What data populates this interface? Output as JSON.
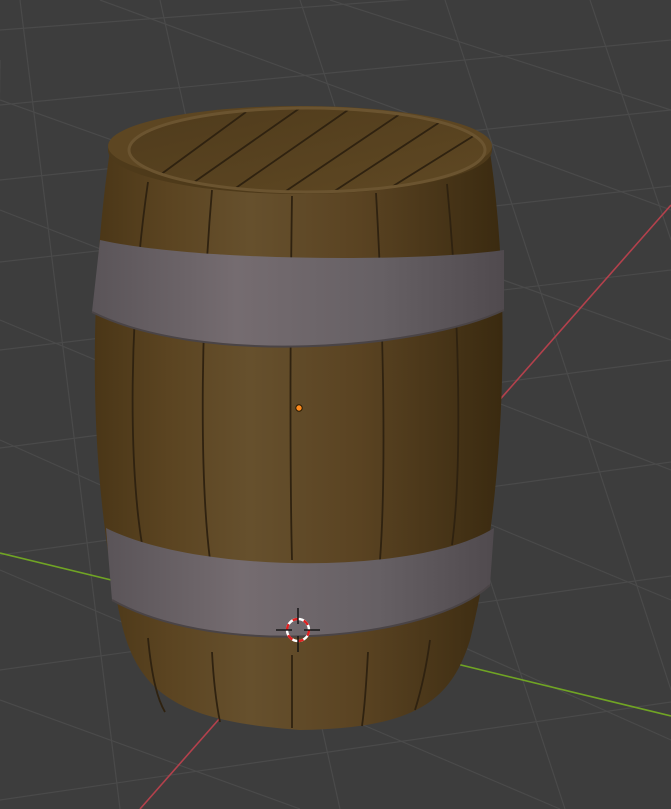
{
  "viewport": {
    "background_color": "#3d3d3d",
    "grid_color": "#4a4a4a",
    "x_axis_color": "#b3414c",
    "y_axis_color": "#70a424"
  },
  "object": {
    "name": "Barrel",
    "wood_color": "#5a4525",
    "band_color": "#6a6266",
    "selected": false
  },
  "origin_marker": {
    "color": "#ff8a1c"
  },
  "cursor_3d": {
    "icon": "crosshair-target-icon"
  }
}
